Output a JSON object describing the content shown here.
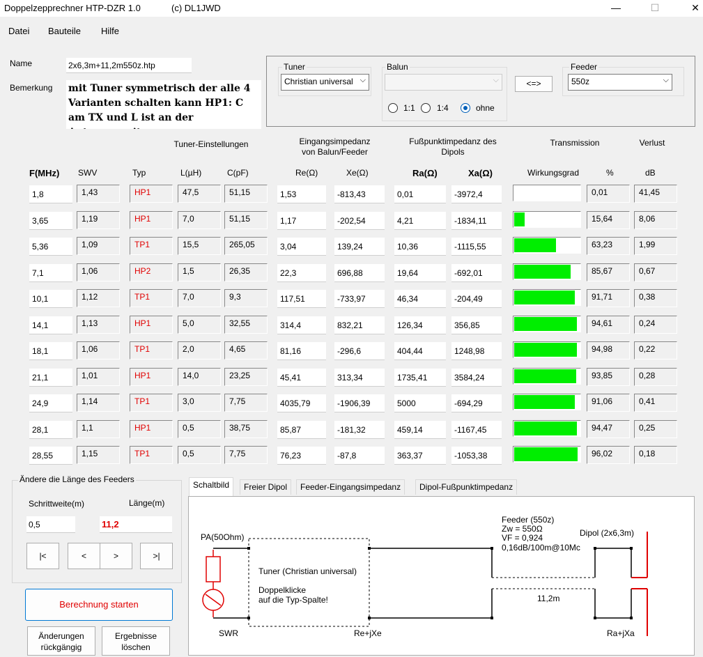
{
  "window": {
    "title": "Doppelzepprechner HTP-DZR 1.0",
    "copyright": "(c) DL1JWD",
    "minimize": "—",
    "maximize": "☐",
    "close": "✕"
  },
  "menu": {
    "file": "Datei",
    "parts": "Bauteile",
    "help": "Hilfe"
  },
  "form": {
    "name_label": "Name",
    "name_value": "2x6,3m+11,2m550z.htp",
    "remark_label": "Bemerkung",
    "remark_value": "mit Tuner symmetrisch der alle 4 Varianten schalten kann HP1: C am TX und L ist an der Antennenseite"
  },
  "selectors": {
    "tuner_label": "Tuner",
    "tuner_value": "Christian universal",
    "balun_label": "Balun",
    "balun_value": "",
    "swap_label": "<=>",
    "feeder_label": "Feeder",
    "feeder_value": "550z",
    "ratio_options": [
      "1:1",
      "1:4",
      "ohne"
    ],
    "ratio_selected": "ohne"
  },
  "group_headers": {
    "tuner": "Tuner-Einstellungen",
    "input_impedance": "Eingangsimpedanz\nvon Balun/Feeder",
    "feed_impedance": "Fußpunktimpedanz des\nDipols",
    "transmission": "Transmission",
    "loss": "Verlust"
  },
  "columns": [
    "F(MHz)",
    "SWV",
    "Typ",
    "L(µH)",
    "C(pF)",
    "Re(Ω)",
    "Xe(Ω)",
    "Ra(Ω)",
    "Xa(Ω)",
    "Wirkungsgrad",
    "%",
    "dB"
  ],
  "rows": [
    {
      "f": "1,8",
      "swv": "1,43",
      "typ": "HP1",
      "l": "47,5",
      "c": "51,15",
      "re": "1,53",
      "xe": "-813,43",
      "ra": "0,01",
      "xa": "-3972,4",
      "eff": 0.01,
      "pct": "0,01",
      "db": "41,45"
    },
    {
      "f": "3,65",
      "swv": "1,19",
      "typ": "HP1",
      "l": "7,0",
      "c": "51,15",
      "re": "1,17",
      "xe": "-202,54",
      "ra": "4,21",
      "xa": "-1834,11",
      "eff": 15.64,
      "pct": "15,64",
      "db": "8,06"
    },
    {
      "f": "5,36",
      "swv": "1,09",
      "typ": "TP1",
      "l": "15,5",
      "c": "265,05",
      "re": "3,04",
      "xe": "139,24",
      "ra": "10,36",
      "xa": "-1115,55",
      "eff": 63.23,
      "pct": "63,23",
      "db": "1,99"
    },
    {
      "f": "7,1",
      "swv": "1,06",
      "typ": "HP2",
      "l": "1,5",
      "c": "26,35",
      "re": "22,3",
      "xe": "696,88",
      "ra": "19,64",
      "xa": "-692,01",
      "eff": 85.67,
      "pct": "85,67",
      "db": "0,67"
    },
    {
      "f": "10,1",
      "swv": "1,12",
      "typ": "TP1",
      "l": "7,0",
      "c": "9,3",
      "re": "117,51",
      "xe": "-733,97",
      "ra": "46,34",
      "xa": "-204,49",
      "eff": 91.71,
      "pct": "91,71",
      "db": "0,38"
    },
    {
      "f": "14,1",
      "swv": "1,13",
      "typ": "HP1",
      "l": "5,0",
      "c": "32,55",
      "re": "314,4",
      "xe": "832,21",
      "ra": "126,34",
      "xa": "356,85",
      "eff": 94.61,
      "pct": "94,61",
      "db": "0,24"
    },
    {
      "f": "18,1",
      "swv": "1,06",
      "typ": "TP1",
      "l": "2,0",
      "c": "4,65",
      "re": "81,16",
      "xe": "-296,6",
      "ra": "404,44",
      "xa": "1248,98",
      "eff": 94.98,
      "pct": "94,98",
      "db": "0,22"
    },
    {
      "f": "21,1",
      "swv": "1,01",
      "typ": "HP1",
      "l": "14,0",
      "c": "23,25",
      "re": "45,41",
      "xe": "313,34",
      "ra": "1735,41",
      "xa": "3584,24",
      "eff": 93.85,
      "pct": "93,85",
      "db": "0,28"
    },
    {
      "f": "24,9",
      "swv": "1,14",
      "typ": "TP1",
      "l": "3,0",
      "c": "7,75",
      "re": "4035,79",
      "xe": "-1906,39",
      "ra": "5000",
      "xa": "-694,29",
      "eff": 91.06,
      "pct": "91,06",
      "db": "0,41"
    },
    {
      "f": "28,1",
      "swv": "1,1",
      "typ": "HP1",
      "l": "0,5",
      "c": "38,75",
      "re": "85,87",
      "xe": "-181,32",
      "ra": "459,14",
      "xa": "-1167,45",
      "eff": 94.47,
      "pct": "94,47",
      "db": "0,25"
    },
    {
      "f": "28,55",
      "swv": "1,15",
      "typ": "TP1",
      "l": "0,5",
      "c": "7,75",
      "re": "76,23",
      "xe": "-87,8",
      "ra": "363,37",
      "xa": "-1053,38",
      "eff": 96.02,
      "pct": "96,02",
      "db": "0,18"
    }
  ],
  "feeder_length": {
    "group_title": "Ändere die Länge des Feeders",
    "step_label": "Schrittweite(m)",
    "length_label": "Länge(m)",
    "step_value": "0,5",
    "length_value": "11,2",
    "nav": [
      "|<",
      "<",
      ">",
      ">|"
    ]
  },
  "actions": {
    "calculate": "Berechnung starten",
    "undo": "Änderungen\nrückgängig",
    "clear": "Ergebnisse\nlöschen"
  },
  "tabs": [
    "Schaltbild",
    "Freier Dipol",
    "Feeder-Eingangsimpedanz",
    "Dipol-Fußpunktimpedanz"
  ],
  "schematic": {
    "pa": "PA(50Ohm)",
    "swr": "SWR",
    "tuner": "Tuner (Christian universal)",
    "hint1": "Doppelklicke",
    "hint2": "auf die Typ-Spalte!",
    "feeder1": "Feeder (550z)",
    "feeder2": "Zw = 550Ω",
    "feeder3": "VF = 0,924",
    "feeder4": "0,16dB/100m@10Mc",
    "dipol": "Dipol (2x6,3m)",
    "length": "11,2m",
    "rejxe": "Re+jXe",
    "rajxa": "Ra+jXa"
  },
  "colors": {
    "bar_fill": "#00ee00",
    "type_text": "#e00000",
    "length_text": "#e00000",
    "calc_text": "#e00000",
    "accent": "#005fb8"
  }
}
